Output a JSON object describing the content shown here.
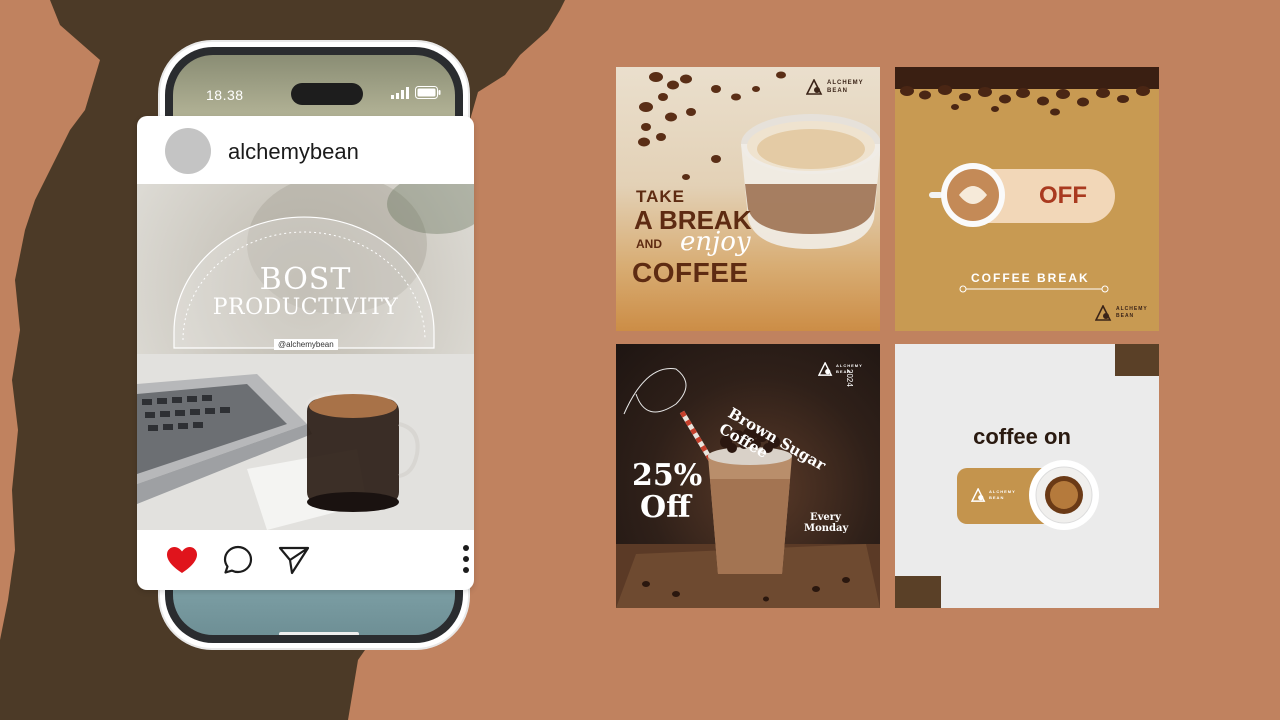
{
  "status_bar": {
    "time": "18.38"
  },
  "instagram_post": {
    "username": "alchemybean",
    "headline_line1": "BOST",
    "headline_line2": "PRODUCTIVITY",
    "handle": "@alchemybean"
  },
  "posts": {
    "take_a_break": {
      "line1": "TAKE",
      "line2": "A BREAK",
      "line3_and": "AND",
      "line3_script": "enjoy",
      "line4": "COFFEE",
      "brand_line1": "ALCHEMY",
      "brand_line2": "BEAN"
    },
    "offer": {
      "badge_text": "OFF",
      "caption": "COFFEE BREAK",
      "brand_line1": "ALCHEMY",
      "brand_line2": "BEAN"
    },
    "brown_sugar": {
      "discount": "25%",
      "discount_word": "Off",
      "curved_title": "Brown Sugar Coffee",
      "every": "Every",
      "day": "Monday",
      "year": "2024",
      "brand_line1": "ALCHEMY",
      "brand_line2": "BEAN"
    },
    "coffee_on": {
      "title": "coffee on",
      "brand_line1": "ALCHEMY",
      "brand_line2": "BEAN"
    }
  },
  "colors": {
    "background": "#c0825f",
    "dark_shape": "#4c3a27",
    "accent_brown": "#7a3a1a",
    "gold": "#c89a52",
    "like_red": "#e0141c"
  },
  "icons": [
    "signal-icon",
    "battery-icon",
    "heart-icon",
    "comment-icon",
    "share-icon",
    "more-icon",
    "brand-logo-icon"
  ]
}
